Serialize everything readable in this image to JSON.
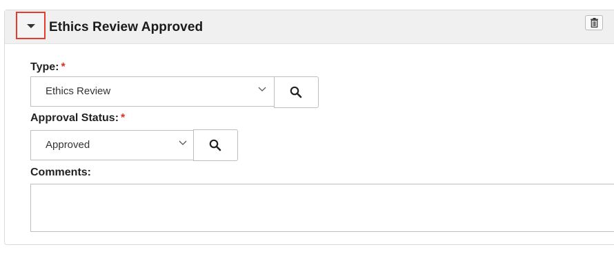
{
  "panel": {
    "title": "Ethics Review Approved",
    "toggle_icon": "caret-down-icon",
    "delete_icon": "trash-icon"
  },
  "form": {
    "required_mark": "*",
    "type": {
      "label": "Type:",
      "value": "Ethics Review"
    },
    "approval_status": {
      "label": "Approval Status:",
      "value": "Approved"
    },
    "comments": {
      "label": "Comments:",
      "value": ""
    }
  },
  "colors": {
    "highlight": "#e53b2c",
    "required": "#d9321f",
    "header_bg": "#f0f0f0"
  }
}
